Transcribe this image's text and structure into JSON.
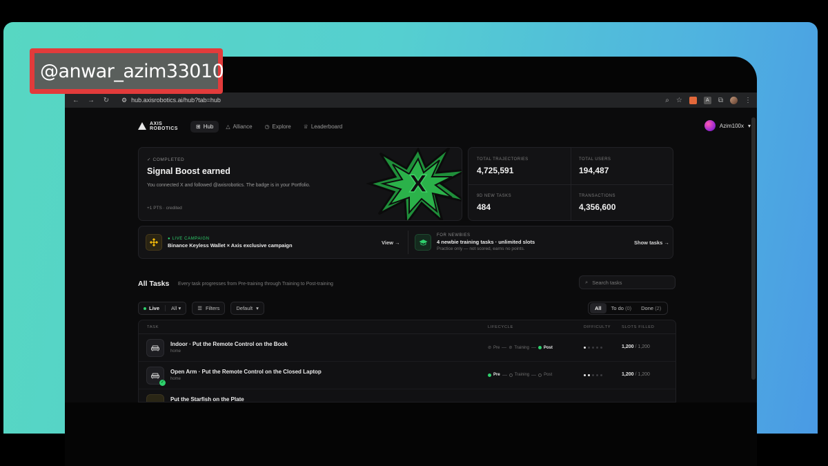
{
  "watermark": {
    "handle": "@anwar_azim33010"
  },
  "browser": {
    "url": "hub.axisrobotics.ai/hub?tab=hub"
  },
  "brand": {
    "line1": "AXIS",
    "line2": "ROBOTICS"
  },
  "nav": {
    "items": [
      {
        "label": "Hub",
        "icon": "hub-icon",
        "active": true
      },
      {
        "label": "Alliance",
        "icon": "triangle-icon",
        "active": false
      },
      {
        "label": "Explore",
        "icon": "compass-icon",
        "active": false
      },
      {
        "label": "Leaderboard",
        "icon": "trophy-icon",
        "active": false
      }
    ],
    "user": "Azim100x"
  },
  "hero": {
    "tag": "✓ COMPLETED",
    "title": "Signal Boost earned",
    "description": "You connected X and followed @axisrobotics. The badge is in your Portfolio.",
    "points": "+1 PTS · credited",
    "badge_letter": "X"
  },
  "stats": [
    {
      "label": "TOTAL TRAJECTORIES",
      "value": "4,725,591"
    },
    {
      "label": "TOTAL USERS",
      "value": "194,487"
    },
    {
      "label": "9D NEW TASKS",
      "value": "484"
    },
    {
      "label": "TRANSACTIONS",
      "value": "4,356,600"
    }
  ],
  "campaigns": [
    {
      "label": "● LIVE CAMPAIGN",
      "title": "Binance Keyless Wallet × Axis exclusive campaign",
      "subtitle": "",
      "link": "View →",
      "label_color": "#2fd06d"
    },
    {
      "label": "FOR NEWBIES",
      "title": "4 newbie training tasks · unlimited slots",
      "subtitle": "Practice only — not scored, earns no points.",
      "link": "Show tasks →",
      "label_color": "#8a8a8a"
    }
  ],
  "tasks_header": {
    "title": "All Tasks",
    "subtitle": "Every task progresses from Pre-training through Training to Post-training",
    "search_placeholder": "Search tasks"
  },
  "filters": {
    "live": "Live",
    "all": "All",
    "filters": "Filters",
    "sort": "Default"
  },
  "scope": [
    {
      "label": "All",
      "count": "",
      "active": true
    },
    {
      "label": "To do",
      "count": "(0)",
      "active": false
    },
    {
      "label": "Done",
      "count": "(2)",
      "active": false
    }
  ],
  "table": {
    "columns": [
      "TASK",
      "LIFECYCLE",
      "DIFFICULTY",
      "SLOTS FILLED"
    ],
    "lifecycle_steps": [
      "Pre",
      "Training",
      "Post"
    ],
    "rows": [
      {
        "title": "Indoor · Put the Remote Control on the Book",
        "category": "home",
        "active_step": 2,
        "difficulty": 1,
        "filled": "1,200",
        "total": "/ 1,200",
        "done": false
      },
      {
        "title": "Open Arm · Put the Remote Control on the Closed Laptop",
        "category": "home",
        "active_step": 0,
        "difficulty": 2,
        "filled": "1,200",
        "total": "/ 1,200",
        "done": true
      },
      {
        "title": "Put the Starfish on the Plate",
        "category": "",
        "active_step": 0,
        "difficulty": 1,
        "filled": "",
        "total": "",
        "done": false
      }
    ]
  },
  "colors": {
    "accent_green": "#2fd06d",
    "badge_green": "#1f8f3a",
    "gradient_start": "#57d7c2",
    "gradient_end": "#4a9ae4"
  }
}
